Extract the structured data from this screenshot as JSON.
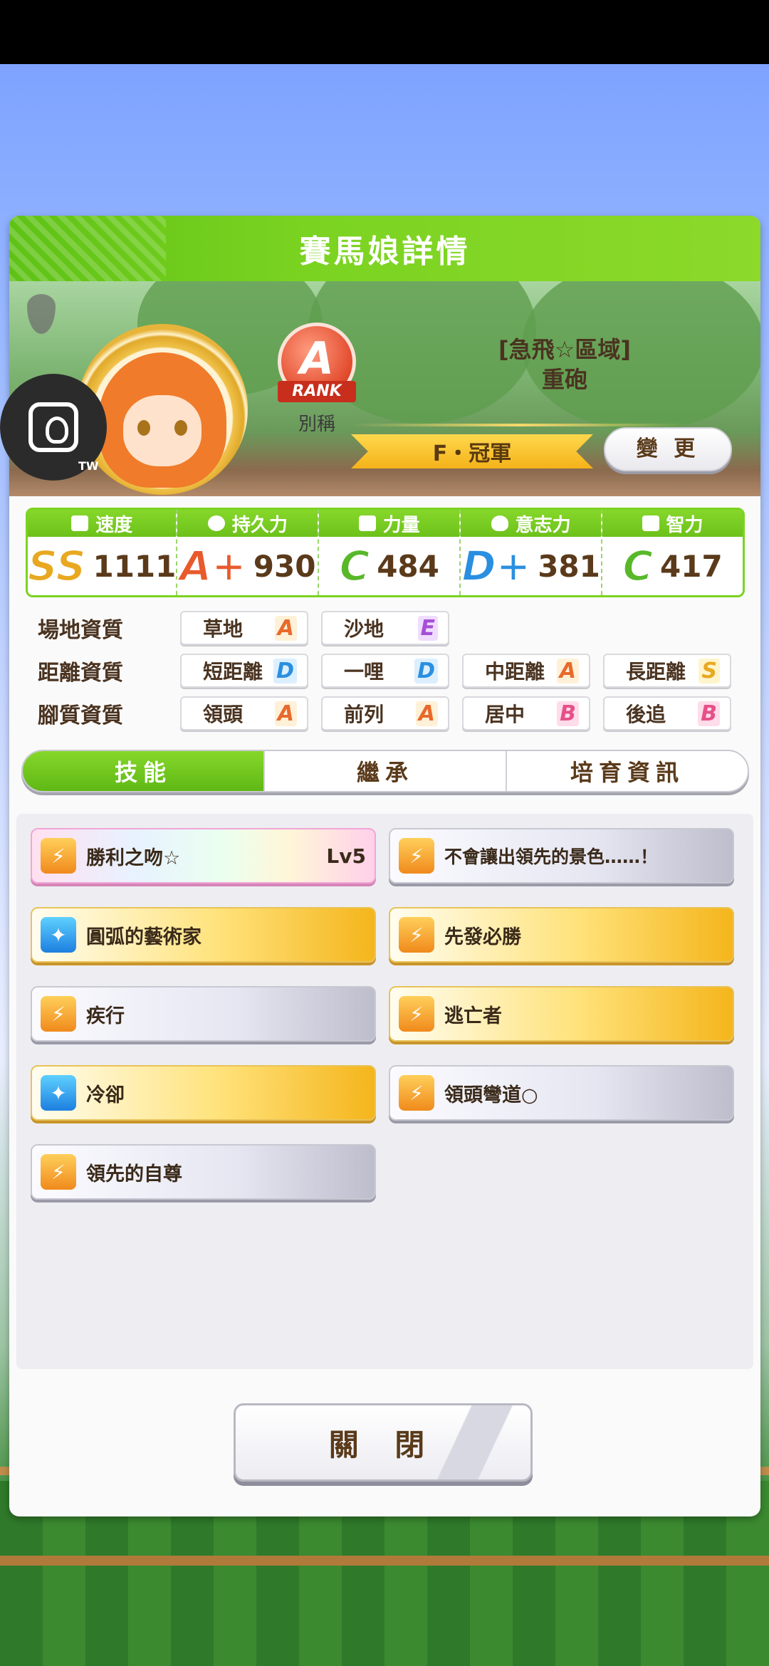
{
  "dialog": {
    "title": "賽馬娘詳情",
    "rank": {
      "letter": "A",
      "ribbon": "RANK",
      "nickname_label": "別稱"
    },
    "nickname": "[急飛☆區域]\n重砲",
    "nickname_line1": "[急飛☆區域]",
    "nickname_line2": "重砲",
    "champion": "F・冠軍",
    "change_button": "變 更"
  },
  "stats": [
    {
      "label": "速度",
      "grade": "SS",
      "value": "1111",
      "icon": "shoe-icon"
    },
    {
      "label": "持久力",
      "grade": "A+",
      "value": "930",
      "icon": "heart-icon"
    },
    {
      "label": "力量",
      "grade": "C",
      "value": "484",
      "icon": "muscle-icon"
    },
    {
      "label": "意志力",
      "grade": "D+",
      "value": "381",
      "icon": "flame-icon"
    },
    {
      "label": "智力",
      "grade": "C",
      "value": "417",
      "icon": "graduation-cap-icon"
    }
  ],
  "aptitudes": {
    "surface": {
      "label": "場地資質",
      "items": [
        {
          "name": "草地",
          "grade": "A"
        },
        {
          "name": "沙地",
          "grade": "E"
        }
      ]
    },
    "distance": {
      "label": "距離資質",
      "items": [
        {
          "name": "短距離",
          "grade": "D"
        },
        {
          "name": "一哩",
          "grade": "D"
        },
        {
          "name": "中距離",
          "grade": "A"
        },
        {
          "name": "長距離",
          "grade": "S"
        }
      ]
    },
    "style": {
      "label": "腳質資質",
      "items": [
        {
          "name": "領頭",
          "grade": "A"
        },
        {
          "name": "前列",
          "grade": "A"
        },
        {
          "name": "居中",
          "grade": "B"
        },
        {
          "name": "後追",
          "grade": "B"
        }
      ]
    }
  },
  "tabs": [
    {
      "label": "技能",
      "active": true
    },
    {
      "label": "繼承",
      "active": false
    },
    {
      "label": "培育資訊",
      "active": false
    }
  ],
  "skills": [
    {
      "name": "勝利之吻☆",
      "level": "Lv5",
      "style": "rainbow",
      "icon": "speed-skill-icon"
    },
    {
      "name": "不會讓出領先的景色……！",
      "level": "",
      "style": "plain",
      "icon": "speed-skill-icon"
    },
    {
      "name": "圓弧的藝術家",
      "level": "",
      "style": "gold",
      "icon": "recovery-skill-icon"
    },
    {
      "name": "先發必勝",
      "level": "",
      "style": "gold",
      "icon": "speed-skill-icon"
    },
    {
      "name": "疾行",
      "level": "",
      "style": "plain",
      "icon": "speed-skill-icon"
    },
    {
      "name": "逃亡者",
      "level": "",
      "style": "gold",
      "icon": "speed-skill-icon"
    },
    {
      "name": "冷卻",
      "level": "",
      "style": "gold",
      "icon": "recovery-skill-icon"
    },
    {
      "name": "領頭彎道○",
      "level": "",
      "style": "plain",
      "icon": "speed-skill-icon"
    },
    {
      "name": "領先的自尊",
      "level": "",
      "style": "plain",
      "icon": "speed-skill-icon"
    }
  ],
  "close_button": "關 閉",
  "overlay": {
    "tag": "TW"
  },
  "colors": {
    "accent_green": "#7bd321",
    "brown_text": "#5a3a1a"
  }
}
